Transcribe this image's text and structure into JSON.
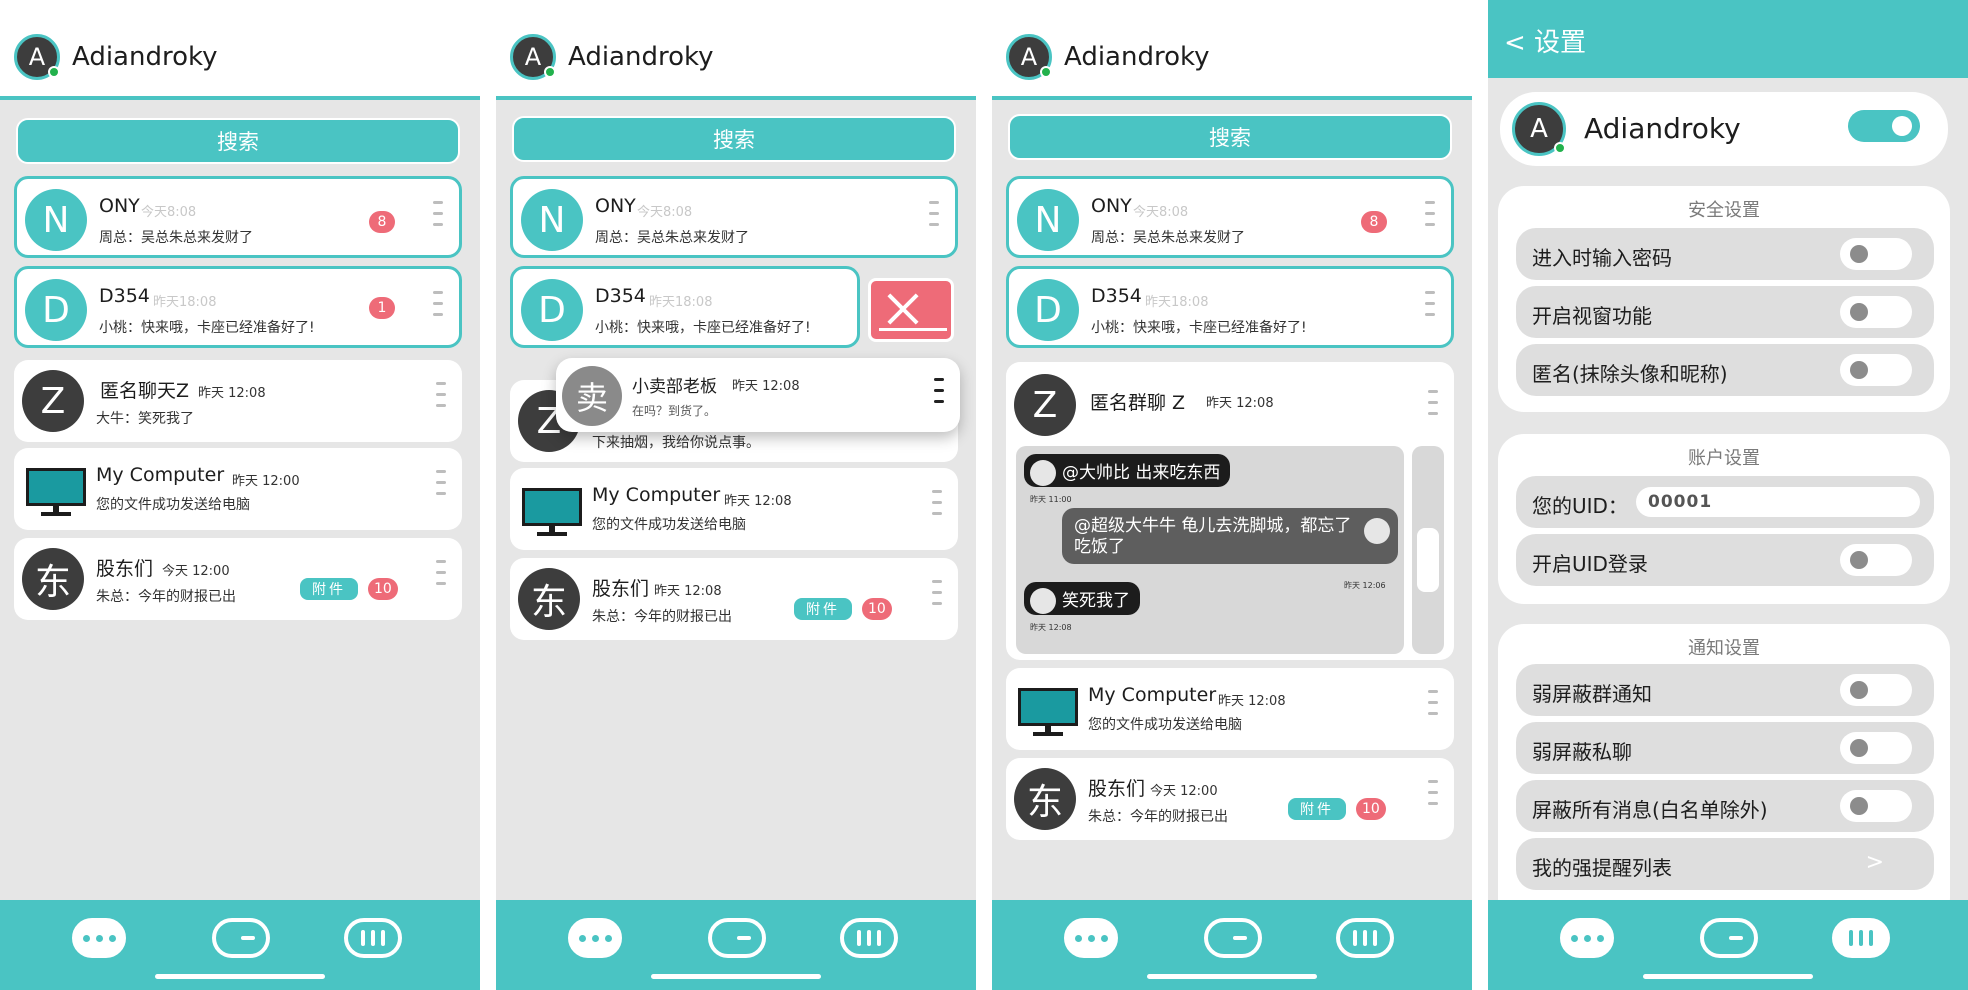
{
  "user": {
    "name": "Adiandroky",
    "initial": "A"
  },
  "search_label": "搜索",
  "chats": {
    "ony": {
      "initial": "N",
      "name": "ONY",
      "time": "今天8:08",
      "preview": "周总：吴总朱总来发财了",
      "badge": "8"
    },
    "d354": {
      "initial": "D",
      "name": "D354",
      "time": "昨天18:08",
      "preview": "小桃：快来哦，卡座已经准备好了!",
      "badge": "1"
    },
    "anon_s1": {
      "initial": "Z",
      "name": "匿名聊天Z",
      "time": "昨天 12:08",
      "preview": "大牛：笑死我了"
    },
    "anon_s2": {
      "initial": "Z",
      "name": "匿名聊天Z",
      "preview": "下来抽烟，我给你说点事。"
    },
    "anon_s3": {
      "initial": "Z",
      "name": "匿名群聊 Z",
      "time": "昨天 12:08"
    },
    "computer": {
      "icon": "monitor-icon",
      "name": "My Computer",
      "time_a": "昨天 12:00",
      "time_b": "昨天 12:08",
      "preview": "您的文件成功发送给电脑"
    },
    "shareholders": {
      "initial": "东",
      "name": "股东们",
      "time_a": "今天 12:00",
      "time_b": "昨天 12:08",
      "preview": "朱总：今年的财报已出",
      "tag": "附件",
      "badge": "10"
    }
  },
  "popup": {
    "initial": "卖",
    "name": "小卖部老板",
    "time": "昨天 12:08",
    "preview": "在吗？到货了。"
  },
  "group_messages": [
    {
      "text": "@大帅比 出来吃东西",
      "time": "昨天 11:00"
    },
    {
      "text": "@超级大牛牛 龟儿去洗脚城，都忘了吃饭了",
      "time": "昨天 12:06"
    },
    {
      "text": "笑死我了",
      "time": "昨天 12:08"
    }
  ],
  "settings": {
    "title": "< 设置",
    "profile_toggle": true,
    "security": {
      "header": "安全设置",
      "items": [
        {
          "label": "进入时输入密码",
          "on": false
        },
        {
          "label": "开启视窗功能",
          "on": false
        },
        {
          "label": "匿名(抹除头像和昵称)",
          "on": false
        }
      ]
    },
    "account": {
      "header": "账户设置",
      "uid_label": "您的UID：",
      "uid_value": "00001",
      "uid_login": "开启UID登录"
    },
    "notify": {
      "header": "通知设置",
      "items": [
        {
          "label": "弱屏蔽群通知",
          "on": false
        },
        {
          "label": "弱屏蔽私聊",
          "on": false
        },
        {
          "label": "屏蔽所有消息(白名单除外)",
          "on": false
        }
      ],
      "reminder": "我的强提醒列表",
      "reminder_arrow": ">"
    }
  },
  "colors": {
    "accent": "#4ac4c3",
    "badge": "#ee6b78",
    "dark_avatar": "#3d3d3d",
    "background": "#e6e6e6"
  },
  "nav_icons": [
    "chat-bubble-icon",
    "pill-toggle-icon",
    "menu-bars-icon"
  ]
}
